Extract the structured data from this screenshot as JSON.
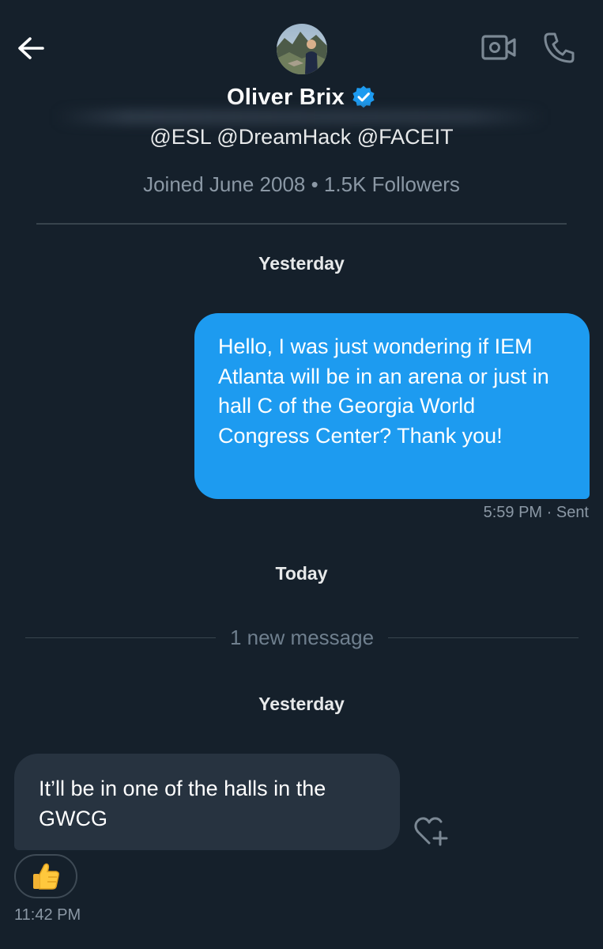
{
  "header": {
    "display_name": "Oliver Brix",
    "handles": "@ESL @DreamHack @FACEIT",
    "meta": "Joined June 2008 • 1.5K Followers"
  },
  "icons": {
    "back": "back-arrow-icon",
    "video": "video-call-icon",
    "phone": "phone-call-icon",
    "verified": "verified-badge-icon",
    "react": "add-reaction-heart-icon",
    "thumbs": "thumbs-up-emoji"
  },
  "colors": {
    "background": "#15202b",
    "outgoing_bubble": "#1d9bf0",
    "incoming_bubble": "#273340",
    "muted_text": "#8b98a5",
    "verified_badge": "#1d9bf0"
  },
  "conversation": {
    "day_1": "Yesterday",
    "outgoing_message": {
      "text": "Hello, I was just wondering if IEM Atlanta will be in an arena or just in hall C of the Georgia World Congress Center? Thank you!",
      "time": "5:59 PM",
      "status": "Sent",
      "meta": "5:59 PM · Sent"
    },
    "day_2": "Today",
    "new_message_separator": "1 new message",
    "day_3": "Yesterday",
    "incoming_message": {
      "text": "It’ll be in one of the halls in the GWCG",
      "reaction": "👍",
      "time": "11:42 PM"
    }
  }
}
